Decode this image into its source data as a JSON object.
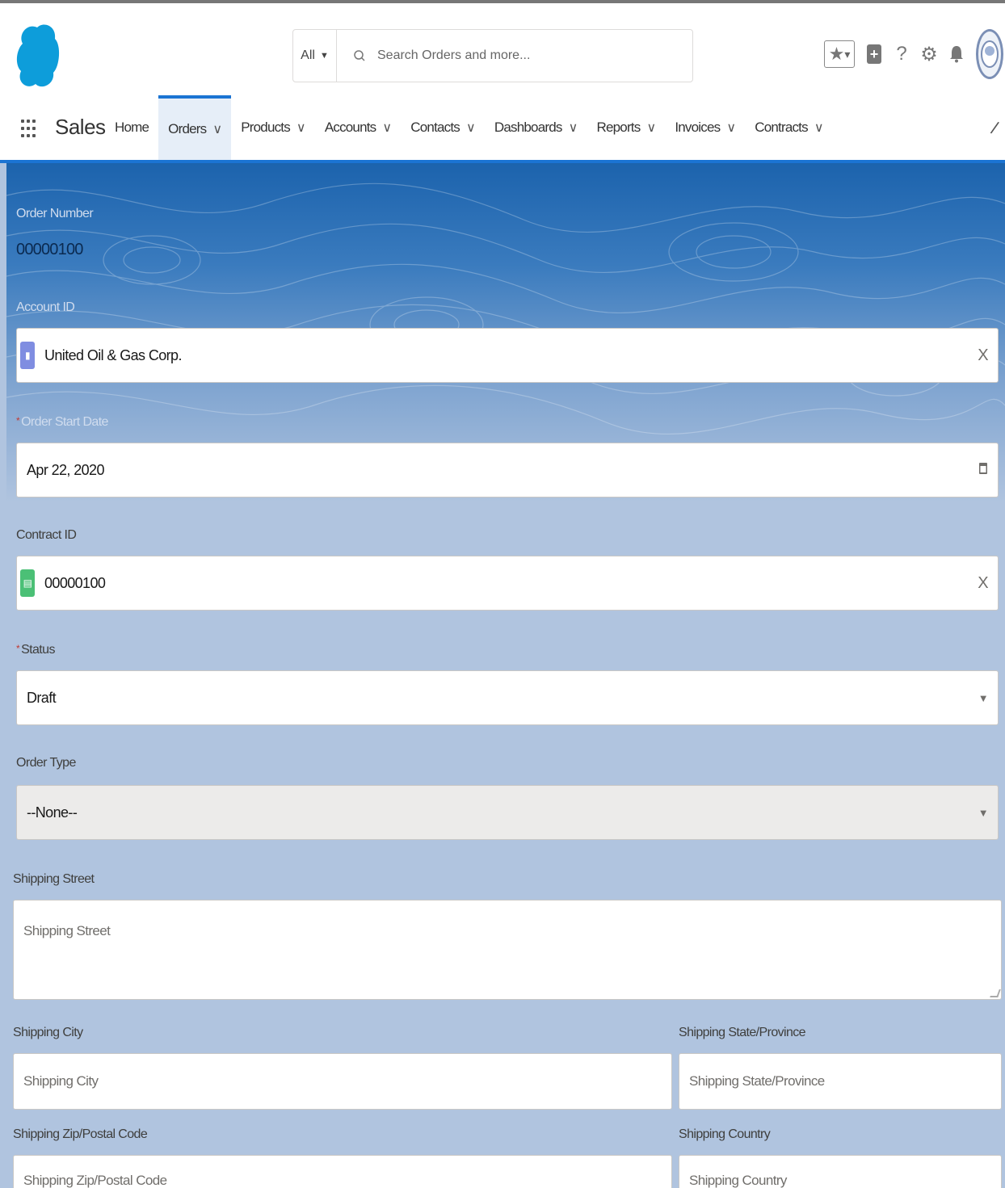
{
  "header": {
    "search_scope": "All",
    "search_placeholder": "Search Orders and more..."
  },
  "nav": {
    "app_name": "Sales",
    "items": [
      {
        "label": "Home",
        "has_menu": false,
        "active": false
      },
      {
        "label": "Orders",
        "has_menu": true,
        "active": true
      },
      {
        "label": "Products",
        "has_menu": true,
        "active": false
      },
      {
        "label": "Accounts",
        "has_menu": true,
        "active": false
      },
      {
        "label": "Contacts",
        "has_menu": true,
        "active": false
      },
      {
        "label": "Dashboards",
        "has_menu": true,
        "active": false
      },
      {
        "label": "Reports",
        "has_menu": true,
        "active": false
      },
      {
        "label": "Invoices",
        "has_menu": true,
        "active": false
      },
      {
        "label": "Contracts",
        "has_menu": true,
        "active": false
      }
    ]
  },
  "form": {
    "order_number_label": "Order Number",
    "order_number_value": "00000100",
    "account_label": "Account ID",
    "account_value": "United Oil & Gas Corp.",
    "start_date_label": "Order Start Date",
    "start_date_value": "Apr 22, 2020",
    "contract_label": "Contract ID",
    "contract_value": "00000100",
    "status_label": "Status",
    "status_value": "Draft",
    "order_type_label": "Order Type",
    "order_type_value": "--None--",
    "street_label": "Shipping Street",
    "street_placeholder": "Shipping Street",
    "city_label": "Shipping City",
    "city_placeholder": "Shipping City",
    "state_label": "Shipping State/Province",
    "state_placeholder": "Shipping State/Province",
    "zip_label": "Shipping Zip/Postal Code",
    "zip_placeholder": "Shipping Zip/Postal Code",
    "country_label": "Shipping Country",
    "country_placeholder": "Shipping Country",
    "clear_glyph": "X"
  },
  "colors": {
    "brand_blue": "#1b74d3",
    "cloud_blue": "#0d9dda",
    "required_red": "#c23934"
  }
}
